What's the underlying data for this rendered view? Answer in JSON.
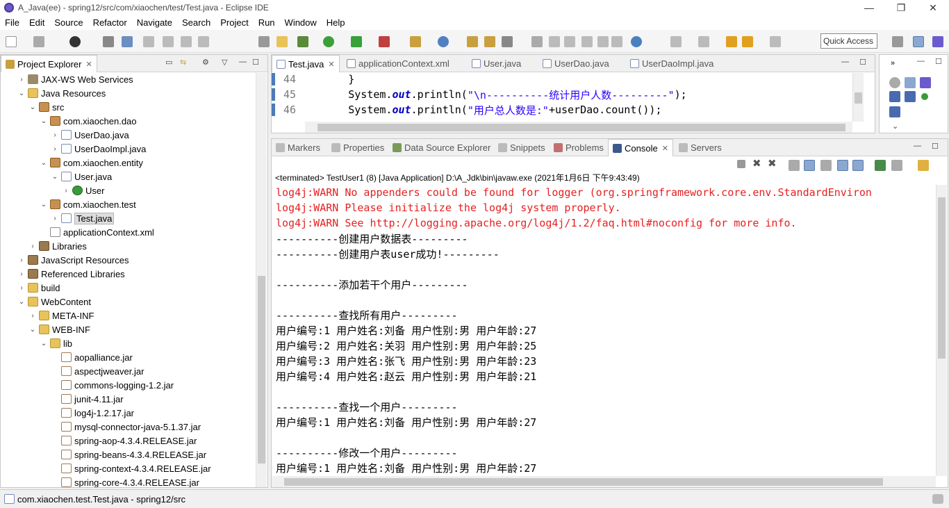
{
  "window": {
    "title": "A_Java(ee) - spring12/src/com/xiaochen/test/Test.java - Eclipse IDE",
    "minimize": "—",
    "restore": "❐",
    "close": "✕"
  },
  "menu": [
    "File",
    "Edit",
    "Source",
    "Refactor",
    "Navigate",
    "Search",
    "Project",
    "Run",
    "Window",
    "Help"
  ],
  "quick_access": "Quick Access",
  "explorer": {
    "title": "Project Explorer",
    "rows": [
      {
        "label": "JAX-WS Web Services",
        "indent": 1,
        "twisty": "›",
        "icon": "ws"
      },
      {
        "label": "Java Resources",
        "indent": 1,
        "twisty": "⌄",
        "icon": "folder"
      },
      {
        "label": "src",
        "indent": 2,
        "twisty": "⌄",
        "icon": "pkg"
      },
      {
        "label": "com.xiaochen.dao",
        "indent": 3,
        "twisty": "⌄",
        "icon": "pkg"
      },
      {
        "label": "UserDao.java",
        "indent": 4,
        "twisty": "›",
        "icon": "java"
      },
      {
        "label": "UserDaoImpl.java",
        "indent": 4,
        "twisty": "›",
        "icon": "java"
      },
      {
        "label": "com.xiaochen.entity",
        "indent": 3,
        "twisty": "⌄",
        "icon": "pkg"
      },
      {
        "label": "User.java",
        "indent": 4,
        "twisty": "⌄",
        "icon": "java"
      },
      {
        "label": "User",
        "indent": 5,
        "twisty": "›",
        "icon": "cls"
      },
      {
        "label": "com.xiaochen.test",
        "indent": 3,
        "twisty": "⌄",
        "icon": "pkg"
      },
      {
        "label": "Test.java",
        "indent": 4,
        "twisty": "›",
        "icon": "java",
        "selected": true
      },
      {
        "label": "applicationContext.xml",
        "indent": 3,
        "twisty": "",
        "icon": "xml"
      },
      {
        "label": "Libraries",
        "indent": 2,
        "twisty": "›",
        "icon": "lib"
      },
      {
        "label": "JavaScript Resources",
        "indent": 1,
        "twisty": "›",
        "icon": "lib"
      },
      {
        "label": "Referenced Libraries",
        "indent": 1,
        "twisty": "›",
        "icon": "lib"
      },
      {
        "label": "build",
        "indent": 1,
        "twisty": "›",
        "icon": "folder"
      },
      {
        "label": "WebContent",
        "indent": 1,
        "twisty": "⌄",
        "icon": "folder"
      },
      {
        "label": "META-INF",
        "indent": 2,
        "twisty": "›",
        "icon": "folder"
      },
      {
        "label": "WEB-INF",
        "indent": 2,
        "twisty": "⌄",
        "icon": "folder"
      },
      {
        "label": "lib",
        "indent": 3,
        "twisty": "⌄",
        "icon": "folder"
      },
      {
        "label": "aopalliance.jar",
        "indent": 4,
        "twisty": "",
        "icon": "jar"
      },
      {
        "label": "aspectjweaver.jar",
        "indent": 4,
        "twisty": "",
        "icon": "jar"
      },
      {
        "label": "commons-logging-1.2.jar",
        "indent": 4,
        "twisty": "",
        "icon": "jar"
      },
      {
        "label": "junit-4.11.jar",
        "indent": 4,
        "twisty": "",
        "icon": "jar"
      },
      {
        "label": "log4j-1.2.17.jar",
        "indent": 4,
        "twisty": "",
        "icon": "jar"
      },
      {
        "label": "mysql-connector-java-5.1.37.jar",
        "indent": 4,
        "twisty": "",
        "icon": "jar"
      },
      {
        "label": "spring-aop-4.3.4.RELEASE.jar",
        "indent": 4,
        "twisty": "",
        "icon": "jar"
      },
      {
        "label": "spring-beans-4.3.4.RELEASE.jar",
        "indent": 4,
        "twisty": "",
        "icon": "jar"
      },
      {
        "label": "spring-context-4.3.4.RELEASE.jar",
        "indent": 4,
        "twisty": "",
        "icon": "jar"
      },
      {
        "label": "spring-core-4.3.4.RELEASE.jar",
        "indent": 4,
        "twisty": "",
        "icon": "jar"
      }
    ]
  },
  "editor": {
    "tabs": [
      "Test.java",
      "applicationContext.xml",
      "User.java",
      "UserDao.java",
      "UserDaoImpl.java"
    ],
    "lines": [
      {
        "num": "44",
        "pre": "        }",
        "str": "",
        "post": ""
      },
      {
        "num": "45",
        "pre": "        System.",
        "fld": "out",
        "mid": ".println(",
        "str": "\"\\n----------统计用户人数---------\"",
        "post": ");"
      },
      {
        "num": "46",
        "pre": "        System.",
        "fld": "out",
        "mid": ".println(",
        "str": "\"用户总人数是:\"",
        "post": "+userDao.count());"
      }
    ]
  },
  "bottom_tabs": [
    "Markers",
    "Properties",
    "Data Source Explorer",
    "Snippets",
    "Problems",
    "Console",
    "Servers"
  ],
  "console": {
    "header": "<terminated> TestUser1 (8) [Java Application] D:\\A_Jdk\\bin\\javaw.exe (2021年1月6日 下午9:43:49)",
    "lines": [
      {
        "text": "log4j:WARN No appenders could be found for logger (org.springframework.core.env.StandardEnviron",
        "err": true
      },
      {
        "text": "log4j:WARN Please initialize the log4j system properly.",
        "err": true
      },
      {
        "text": "log4j:WARN See http://logging.apache.org/log4j/1.2/faq.html#noconfig for more info.",
        "err": true
      },
      {
        "text": "----------创建用户数据表---------",
        "err": false
      },
      {
        "text": "----------创建用户表user成功!---------",
        "err": false
      },
      {
        "text": "",
        "err": false
      },
      {
        "text": "----------添加若干个用户---------",
        "err": false
      },
      {
        "text": "",
        "err": false
      },
      {
        "text": "----------查找所有用户---------",
        "err": false
      },
      {
        "text": "用户编号:1 用户姓名:刘备 用户性别:男 用户年龄:27",
        "err": false
      },
      {
        "text": "用户编号:2 用户姓名:关羽 用户性别:男 用户年龄:25",
        "err": false
      },
      {
        "text": "用户编号:3 用户姓名:张飞 用户性别:男 用户年龄:23",
        "err": false
      },
      {
        "text": "用户编号:4 用户姓名:赵云 用户性别:男 用户年龄:21",
        "err": false
      },
      {
        "text": "",
        "err": false
      },
      {
        "text": "----------查找一个用户---------",
        "err": false
      },
      {
        "text": "用户编号:1 用户姓名:刘备 用户性别:男 用户年龄:27",
        "err": false
      },
      {
        "text": "",
        "err": false
      },
      {
        "text": "----------修改一个用户---------",
        "err": false
      },
      {
        "text": "用户编号:1 用户姓名:刘备 用户性别:男 用户年龄:27",
        "err": false
      }
    ]
  },
  "status": {
    "text": "com.xiaochen.test.Test.java - spring12/src"
  },
  "colors": {
    "error": "#e62020",
    "string": "#2a00ff",
    "field": "#0000c0"
  }
}
